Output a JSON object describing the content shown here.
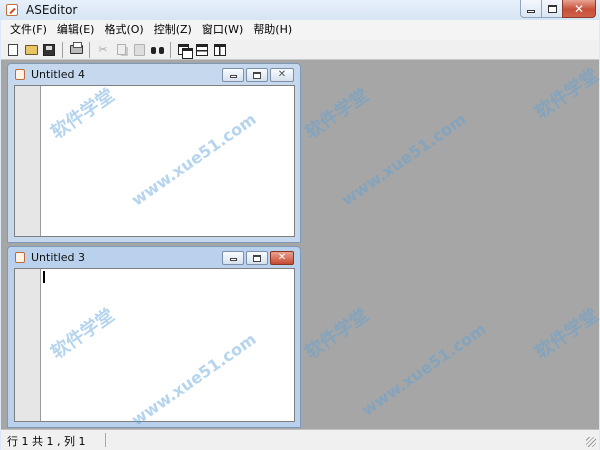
{
  "window": {
    "title": "ASEditor",
    "icon": "pencil-app-icon",
    "controls": {
      "minimize": "minimize-icon",
      "maximize": "maximize-icon",
      "close": "close-icon",
      "close_glyph": "✕"
    }
  },
  "menu": {
    "items": [
      {
        "label": "文件(F)"
      },
      {
        "label": "编辑(E)"
      },
      {
        "label": "格式(O)"
      },
      {
        "label": "控制(Z)"
      },
      {
        "label": "窗口(W)"
      },
      {
        "label": "帮助(H)"
      }
    ]
  },
  "toolbar": {
    "buttons": [
      "new-icon",
      "open-icon",
      "save-icon",
      "print-icon",
      "cut-icon",
      "copy-icon",
      "paste-icon",
      "find-icon",
      "cascade-icon",
      "tile-horizontal-icon",
      "tile-vertical-icon"
    ],
    "cut_glyph": "✂"
  },
  "documents": [
    {
      "title": "Untitled 4",
      "active": false,
      "close_glyph": "✕"
    },
    {
      "title": "Untitled 3",
      "active": true,
      "close_glyph": "✕"
    }
  ],
  "status": {
    "text": "行 1 共 1 , 列 1"
  },
  "watermark": {
    "text": "软件学堂",
    "url": "www.xue51.com"
  },
  "colors": {
    "mdi_background": "#a6a6a6",
    "active_close": "#c6503a",
    "watermark": "#5aa0d7"
  }
}
